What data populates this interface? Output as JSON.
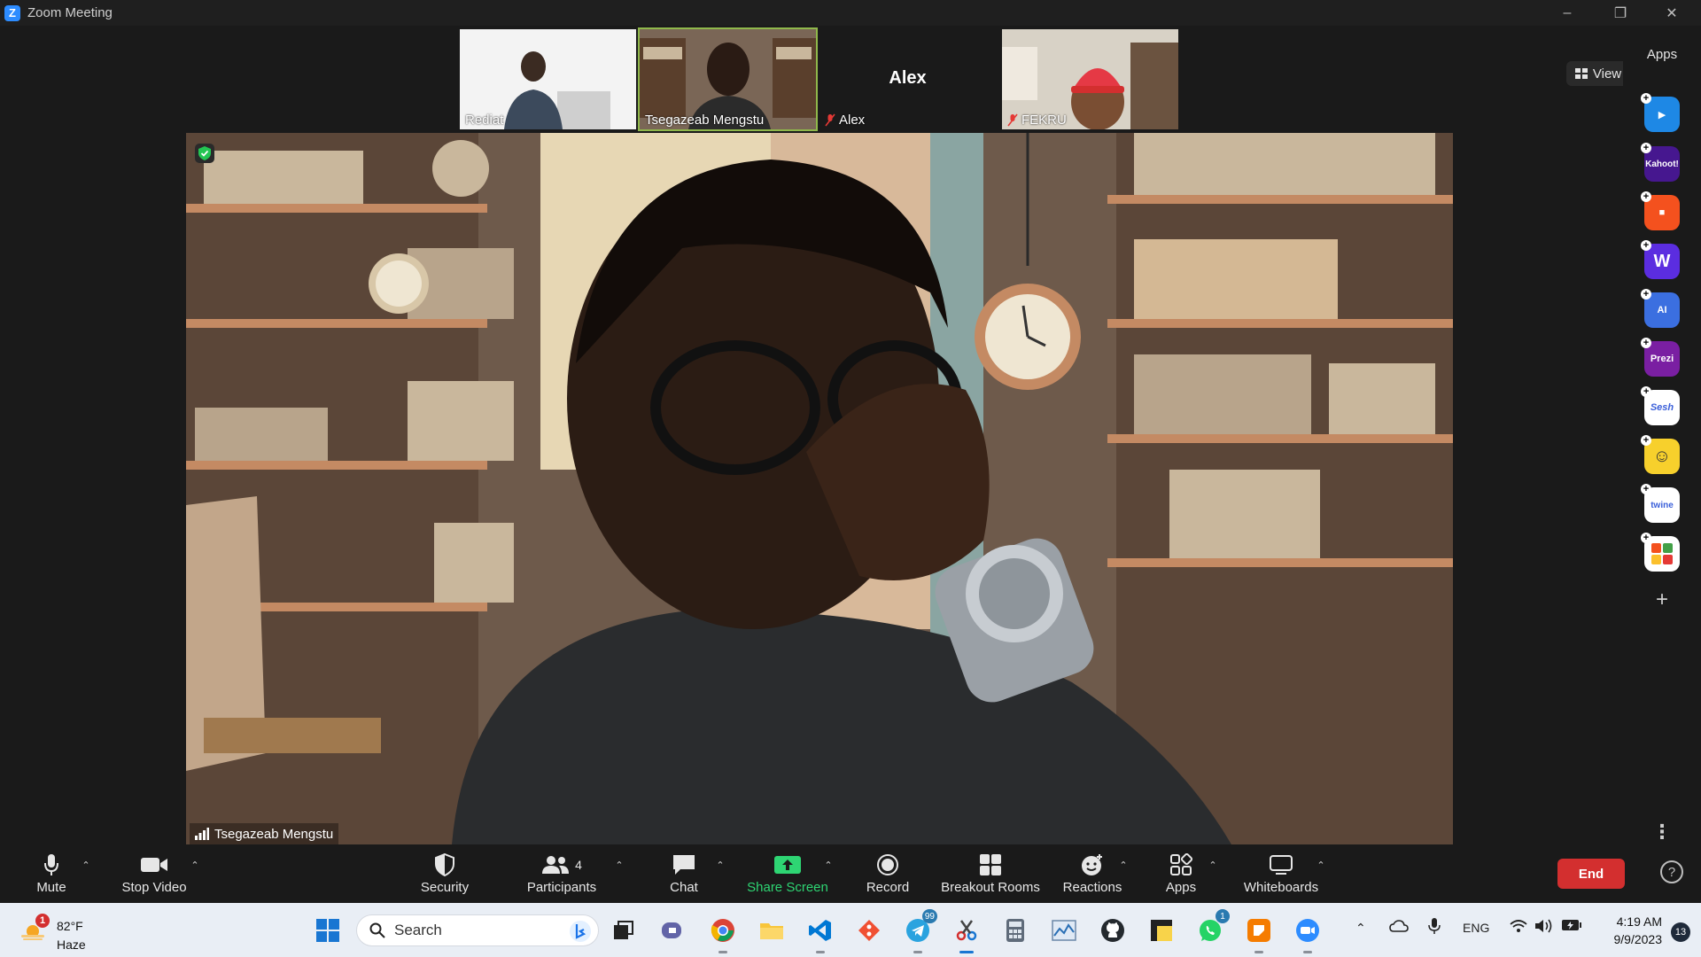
{
  "window": {
    "title": "Zoom Meeting",
    "logo_letter": "Z"
  },
  "thumbnails": [
    {
      "name": "Rediat",
      "video": true,
      "muted": false
    },
    {
      "name": "Tsegazeab Mengstu",
      "video": true,
      "muted": false,
      "active": true
    },
    {
      "name": "Alex",
      "video": false,
      "muted": true,
      "display_name": "Alex"
    },
    {
      "name": "FEKRU",
      "video": true,
      "muted": true
    }
  ],
  "main_video": {
    "speaker_name": "Tsegazeab Mengstu"
  },
  "view_button": {
    "label": "View"
  },
  "apps_panel": {
    "title": "Apps",
    "apps": [
      {
        "name": "Pointer",
        "label": "",
        "color": "#1e88e5"
      },
      {
        "name": "Kahoot!",
        "label": "Kahoot!",
        "color": "#46178f"
      },
      {
        "name": "Miro",
        "label": "",
        "color": "#f4511e"
      },
      {
        "name": "Wooclap",
        "label": "W",
        "color": "#5b2de0"
      },
      {
        "name": "Assistant AI",
        "label": "AI",
        "color": "#3b6fe0"
      },
      {
        "name": "Prezi",
        "label": "Prezi",
        "color": "#7a1fa2"
      },
      {
        "name": "Sesh",
        "label": "Sesh",
        "color": "#ffffff"
      },
      {
        "name": "Emoji app",
        "label": "",
        "color": "#f7d02c"
      },
      {
        "name": "Twine",
        "label": "twine",
        "color": "#ffffff"
      },
      {
        "name": "Mural",
        "label": "",
        "color": "#ffffff"
      }
    ]
  },
  "toolbar": {
    "mute": "Mute",
    "stop_video": "Stop Video",
    "security": "Security",
    "participants": "Participants",
    "participants_count": "4",
    "chat": "Chat",
    "share_screen": "Share Screen",
    "record": "Record",
    "breakout_rooms": "Breakout Rooms",
    "reactions": "Reactions",
    "apps": "Apps",
    "whiteboards": "Whiteboards",
    "end": "End"
  },
  "taskbar": {
    "weather_temp": "82°F",
    "weather_condition": "Haze",
    "weather_badge": "1",
    "search_placeholder": "Search",
    "telegram_badge": "99",
    "whatsapp_badge": "1",
    "language": "ENG",
    "time": "4:19 AM",
    "date": "9/9/2023",
    "notifications": "13"
  },
  "colors": {
    "accent": "#2d8cff",
    "share_green": "#2ed573",
    "end_red": "#d32f2f",
    "active_tile_outline": "#8fb84b"
  }
}
